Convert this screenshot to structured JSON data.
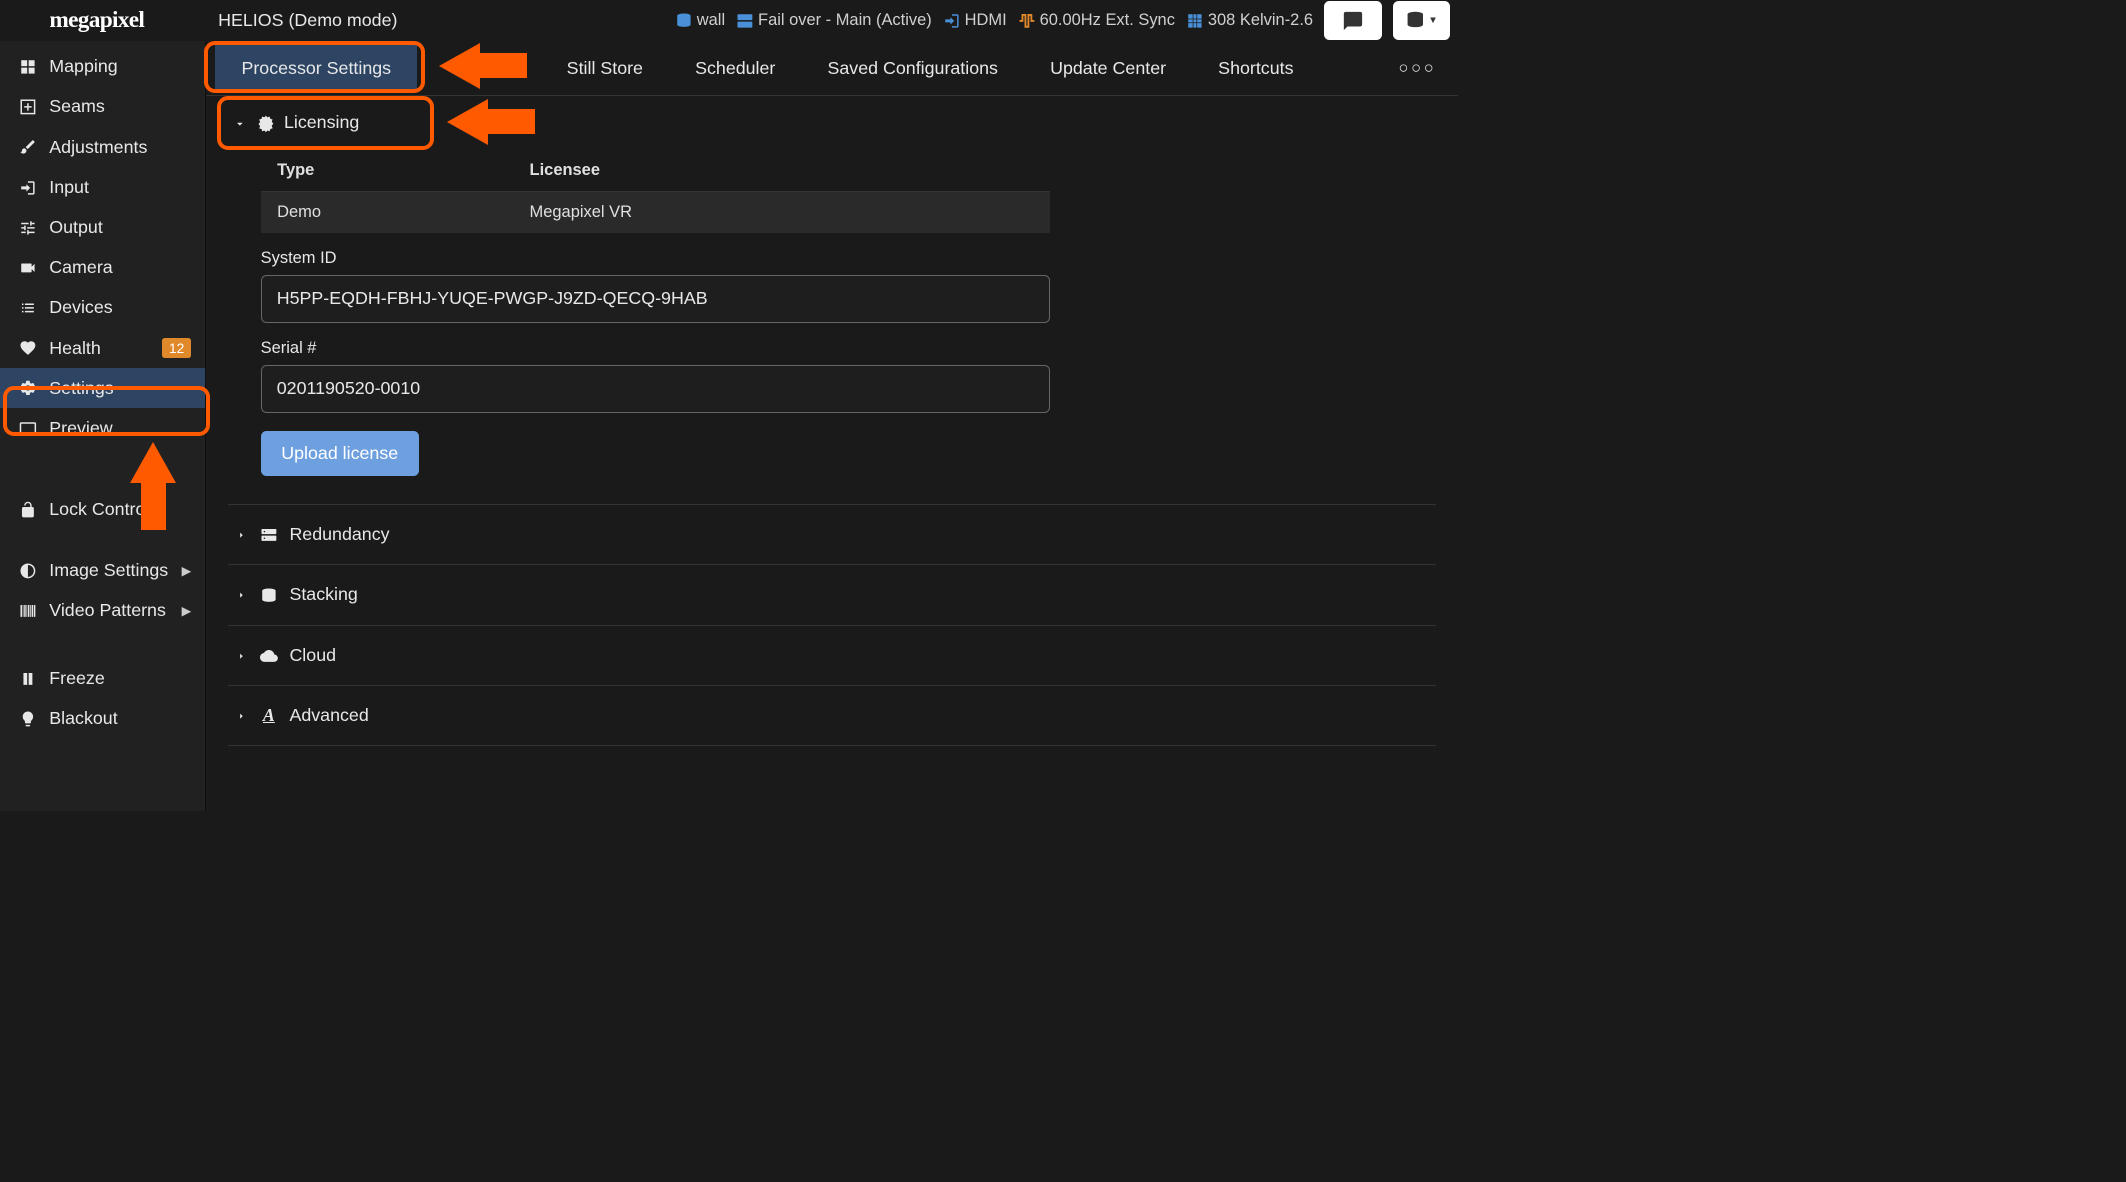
{
  "logo": "megapixel",
  "title": "HELIOS (Demo mode)",
  "status": {
    "wall": "wall",
    "failover": "Fail over - Main (Active)",
    "input": "HDMI",
    "sync": "60.00Hz Ext. Sync",
    "tiles": "308 Kelvin-2.6"
  },
  "sidebar": {
    "items": [
      {
        "label": "Mapping"
      },
      {
        "label": "Seams"
      },
      {
        "label": "Adjustments"
      },
      {
        "label": "Input"
      },
      {
        "label": "Output"
      },
      {
        "label": "Camera"
      },
      {
        "label": "Devices"
      },
      {
        "label": "Health",
        "badge": "12"
      },
      {
        "label": "Settings"
      },
      {
        "label": "Preview"
      }
    ],
    "lock": "Lock Controls",
    "image_settings": "Image Settings",
    "video_patterns": "Video Patterns",
    "freeze": "Freeze",
    "blackout": "Blackout"
  },
  "tabs": {
    "items": [
      "Processor Settings",
      "Still Store",
      "Scheduler",
      "Saved Configurations",
      "Update Center",
      "Shortcuts"
    ]
  },
  "licensing": {
    "header": "Licensing",
    "table": {
      "col_type": "Type",
      "col_licensee": "Licensee",
      "row_type": "Demo",
      "row_licensee": "Megapixel VR"
    },
    "system_id_label": "System ID",
    "system_id_value": "H5PP-EQDH-FBHJ-YUQE-PWGP-J9ZD-QECQ-9HAB",
    "serial_label": "Serial #",
    "serial_value": "0201190520-0010",
    "upload_btn": "Upload license"
  },
  "sections": {
    "redundancy": "Redundancy",
    "stacking": "Stacking",
    "cloud": "Cloud",
    "advanced": "Advanced"
  },
  "colors": {
    "highlight": "#ff5a00",
    "accent": "#6ea0e0",
    "active_bg": "#2d4563"
  }
}
